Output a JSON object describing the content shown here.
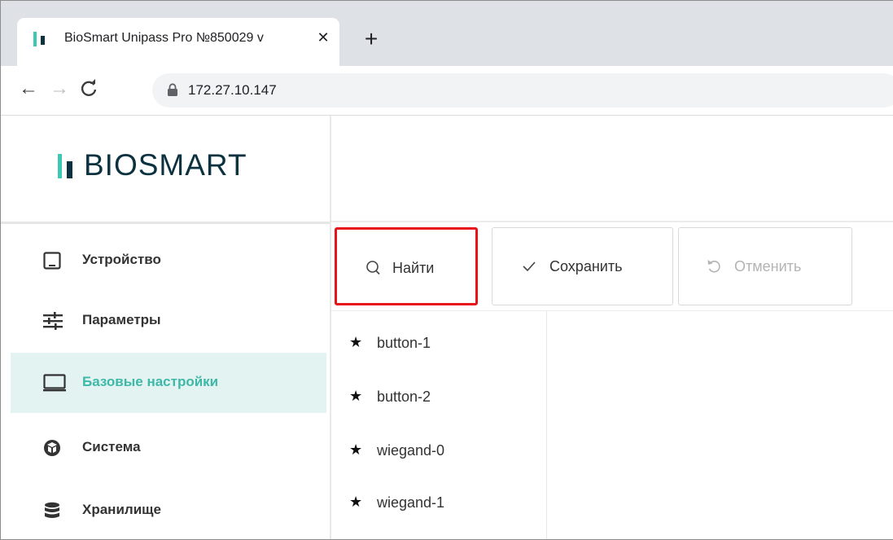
{
  "browser": {
    "tab_title": "BioSmart Unipass Pro №850029 v",
    "tab_close": "✕",
    "new_tab": "+",
    "back": "←",
    "forward": "→",
    "reload": "C",
    "url": "172.27.10.147"
  },
  "sidebar": {
    "logo_text": "BIOSMART",
    "items": [
      {
        "label": "Устройство",
        "icon": "tablet-icon",
        "active": false
      },
      {
        "label": "Параметры",
        "icon": "sliders-icon",
        "active": false
      },
      {
        "label": "Базовые настройки",
        "icon": "monitor-icon",
        "active": true
      },
      {
        "label": "Система",
        "icon": "cube-icon",
        "active": false
      },
      {
        "label": "Хранилище",
        "icon": "database-icon",
        "active": false
      }
    ]
  },
  "toolbar": {
    "find_label": "Найти",
    "save_label": "Сохранить",
    "cancel_label": "Отменить"
  },
  "list": {
    "items": [
      "button-1",
      "button-2",
      "wiegand-0",
      "wiegand-1"
    ]
  },
  "colors": {
    "accent": "#3fb8a8",
    "active_bg": "#e2f3f1",
    "highlight_border": "#e8121a",
    "logo_dark": "#0c3240"
  }
}
